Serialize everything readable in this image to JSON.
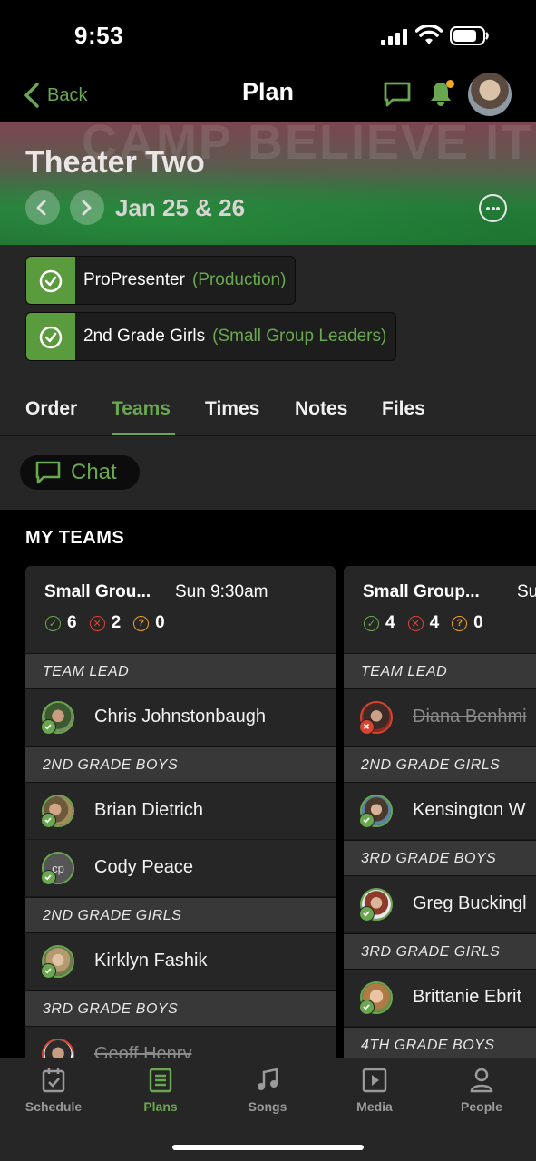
{
  "status": {
    "time": "9:53"
  },
  "nav": {
    "back_label": "Back",
    "title": "Plan"
  },
  "hero": {
    "title": "Theater Two",
    "date": "Jan 25 & 26",
    "background_text": "CAMP BELIEVE IT"
  },
  "assignments": [
    {
      "name": "ProPresenter",
      "role": "(Production)"
    },
    {
      "name": "2nd Grade Girls",
      "role": "(Small Group Leaders)"
    }
  ],
  "tabs": [
    "Order",
    "Teams",
    "Times",
    "Notes",
    "Files"
  ],
  "active_tab": "Teams",
  "chat_label": "Chat",
  "my_teams": {
    "title": "MY TEAMS",
    "cards": [
      {
        "name": "Small Grou...",
        "time": "Sun 9:30am",
        "confirmed": "6",
        "declined": "2",
        "unconfirmed": "0",
        "groups": [
          {
            "position": "TEAM LEAD",
            "people": [
              {
                "name": "Chris Johnstonbaugh",
                "status": "confirmed"
              }
            ]
          },
          {
            "position": "2ND GRADE BOYS",
            "people": [
              {
                "name": "Brian Dietrich",
                "status": "confirmed"
              },
              {
                "name": "Cody Peace",
                "status": "confirmed",
                "initials": "cp"
              }
            ]
          },
          {
            "position": "2ND GRADE GIRLS",
            "people": [
              {
                "name": "Kirklyn Fashik",
                "status": "confirmed"
              }
            ]
          },
          {
            "position": "3RD GRADE BOYS",
            "people": [
              {
                "name": "Geoff Henry",
                "status": "declined"
              }
            ]
          }
        ]
      },
      {
        "name": "Small Group...",
        "time": "Su",
        "confirmed": "4",
        "declined": "4",
        "unconfirmed": "0",
        "groups": [
          {
            "position": "TEAM LEAD",
            "people": [
              {
                "name": "Diana Benhmi",
                "status": "declined"
              }
            ]
          },
          {
            "position": "2ND GRADE GIRLS",
            "people": [
              {
                "name": "Kensington W",
                "status": "confirmed"
              }
            ]
          },
          {
            "position": "3RD GRADE BOYS",
            "people": [
              {
                "name": "Greg Buckingl",
                "status": "confirmed"
              }
            ]
          },
          {
            "position": "3RD GRADE GIRLS",
            "people": [
              {
                "name": "Brittanie Ebrit",
                "status": "confirmed"
              }
            ]
          },
          {
            "position": "4TH GRADE BOYS",
            "people": []
          }
        ]
      }
    ]
  },
  "tab_bar": [
    {
      "label": "Schedule",
      "icon": "calendar-check-icon"
    },
    {
      "label": "Plans",
      "icon": "plan-list-icon"
    },
    {
      "label": "Songs",
      "icon": "music-note-icon"
    },
    {
      "label": "Media",
      "icon": "play-square-icon"
    },
    {
      "label": "People",
      "icon": "person-icon"
    }
  ],
  "active_tab_bar": "Plans",
  "colors": {
    "accent": "#6aa84f",
    "declined": "#d9432f",
    "unconfirmed": "#f0a230",
    "surface": "#262626"
  }
}
